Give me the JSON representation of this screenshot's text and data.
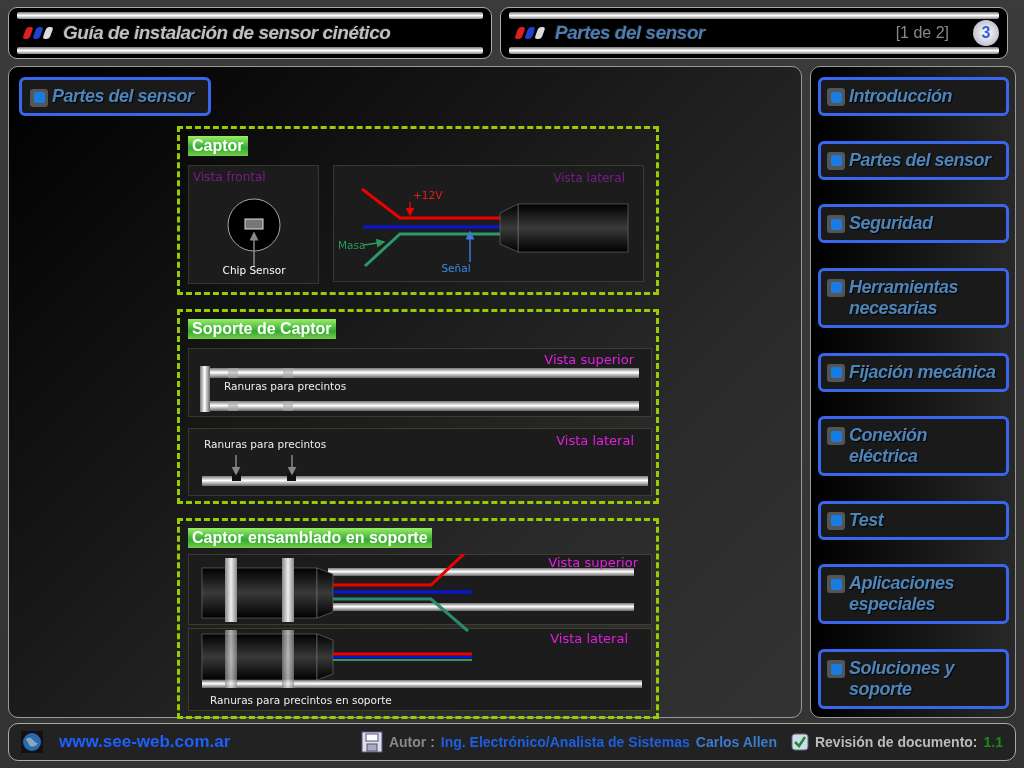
{
  "header": {
    "title": "Guía de instalación de sensor cinético"
  },
  "slide_header": {
    "title": "Partes del sensor",
    "page": "[1 de 2]",
    "number": "3"
  },
  "section_button": "Partes del sensor",
  "diagrams": [
    {
      "kind": "captor",
      "title": "Captor",
      "texts": [
        "Vista frontal",
        "Chip Sensor",
        "Vista lateral",
        "+12V",
        "Masa",
        "Señal"
      ]
    },
    {
      "kind": "soporte",
      "title": "Soporte de Captor",
      "texts": [
        "Vista superior",
        "Ranuras para precintos",
        "Vista lateral",
        "Ranuras para precintos"
      ]
    },
    {
      "kind": "ensamblado",
      "title": "Captor ensamblado en soporte",
      "texts": [
        "Vista superior",
        "Vista lateral",
        "Ranuras para precintos en soporte"
      ]
    }
  ],
  "sidebar": {
    "items": [
      {
        "label": "Introducción"
      },
      {
        "label": "Partes del sensor"
      },
      {
        "label": "Seguridad"
      },
      {
        "label": "Herramientas necesarias"
      },
      {
        "label": "Fijación mecánica"
      },
      {
        "label": "Conexión eléctrica"
      },
      {
        "label": "Test"
      },
      {
        "label": "Aplicaciones especiales"
      },
      {
        "label": "Soluciones y soporte"
      }
    ]
  },
  "footer": {
    "url": "www.see-web.com.ar",
    "author_label": "Autor :",
    "author_role": "Ing. Electrónico/Analista de Sistemas",
    "author_name": "Carlos Allen",
    "revision_label": "Revisión de documento:",
    "revision": "1.1"
  }
}
